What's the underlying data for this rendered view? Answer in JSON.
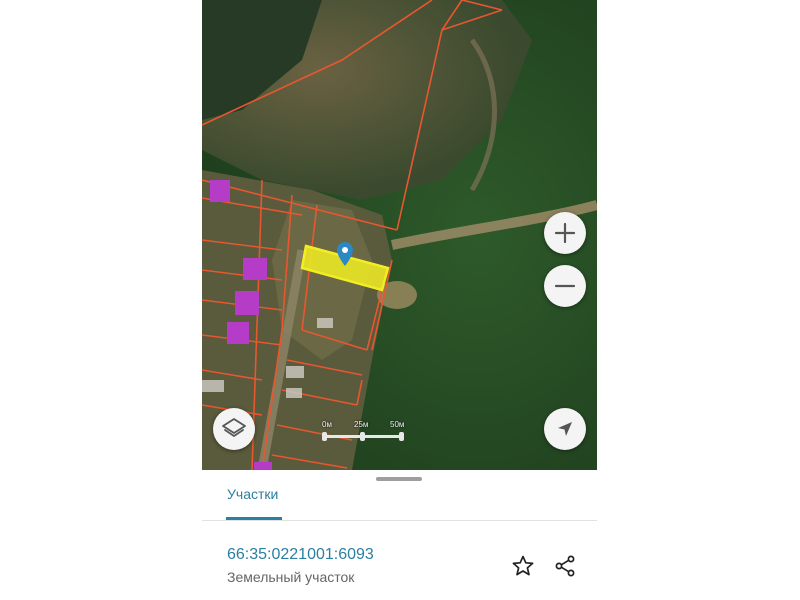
{
  "map": {
    "scale_labels": [
      "0м",
      "25м",
      "50м"
    ],
    "zoom_in_icon": "plus-icon",
    "zoom_out_icon": "minus-icon",
    "layers_icon": "layers-icon",
    "location_icon": "navigation-arrow-icon",
    "marker_icon": "map-pin-icon",
    "colors": {
      "parcel_boundary": "#e8572f",
      "selected_parcel": "#f2ee23",
      "building": "#b43cc7",
      "marker": "#2b88c4"
    }
  },
  "sheet": {
    "tab_label": "Участки",
    "parcel": {
      "cadastral_number": "66:35:0221001:6093",
      "type": "Земельный участок"
    },
    "actions": {
      "favorite_icon": "star-icon",
      "share_icon": "share-icon"
    },
    "accent_color": "#2b7fa0"
  }
}
